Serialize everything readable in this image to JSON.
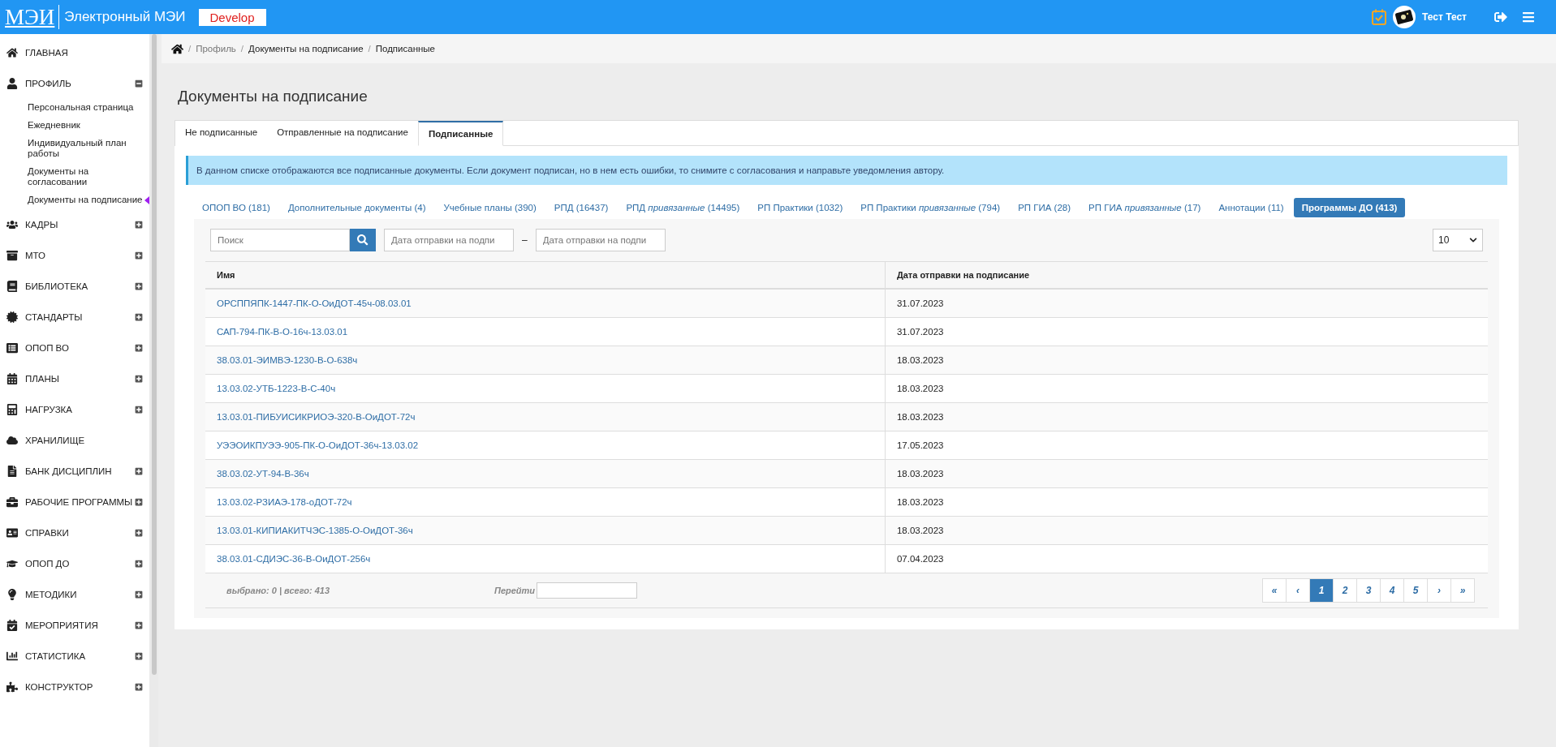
{
  "header": {
    "logo": "МЭИ",
    "title": "Электронный МЭИ",
    "badge": "Develop",
    "user": "Тест Тест"
  },
  "sidebar": {
    "items": [
      {
        "label": "ГЛАВНАЯ",
        "kind": "link"
      },
      {
        "label": "ПРОФИЛЬ",
        "kind": "group",
        "expanded": true,
        "children": [
          {
            "label": "Персональная страница",
            "selected": false
          },
          {
            "label": "Ежедневник",
            "selected": false
          },
          {
            "label": "Индивидуальный план работы",
            "selected": false
          },
          {
            "label": "Документы на согласовании",
            "selected": false
          },
          {
            "label": "Документы на подписание",
            "selected": true
          }
        ]
      },
      {
        "label": "КАДРЫ",
        "kind": "group",
        "expanded": false
      },
      {
        "label": "МТО",
        "kind": "group",
        "expanded": false
      },
      {
        "label": "БИБЛИОТЕКА",
        "kind": "group",
        "expanded": false
      },
      {
        "label": "СТАНДАРТЫ",
        "kind": "group",
        "expanded": false
      },
      {
        "label": "ОПОП ВО",
        "kind": "group",
        "expanded": false
      },
      {
        "label": "ПЛАНЫ",
        "kind": "group",
        "expanded": false
      },
      {
        "label": "НАГРУЗКА",
        "kind": "group",
        "expanded": false
      },
      {
        "label": "ХРАНИЛИЩЕ",
        "kind": "link"
      },
      {
        "label": "БАНК ДИСЦИПЛИН",
        "kind": "group",
        "expanded": false
      },
      {
        "label": "РАБОЧИЕ ПРОГРАММЫ",
        "kind": "group",
        "expanded": false
      },
      {
        "label": "СПРАВКИ",
        "kind": "group",
        "expanded": false
      },
      {
        "label": "ОПОП ДО",
        "kind": "group",
        "expanded": false
      },
      {
        "label": "МЕТОДИКИ",
        "kind": "group",
        "expanded": false
      },
      {
        "label": "МЕРОПРИЯТИЯ",
        "kind": "group",
        "expanded": false
      },
      {
        "label": "СТАТИСТИКА",
        "kind": "group",
        "expanded": false
      },
      {
        "label": "КОНСТРУКТОР",
        "kind": "group",
        "expanded": false
      }
    ]
  },
  "breadcrumb_separator": "/",
  "breadcrumbs": [
    {
      "label": "Профиль",
      "kind": "muted"
    },
    {
      "label": "Документы на подписание",
      "kind": "link"
    },
    {
      "label": "Подписанные",
      "kind": "current"
    }
  ],
  "page_title": "Документы на подписание",
  "tabs": [
    {
      "label": "Не подписанные",
      "selected": false
    },
    {
      "label": "Отправленные на подписание",
      "selected": false
    },
    {
      "label": "Подписанные",
      "selected": true
    }
  ],
  "info": "В данном списке отображаются все подписанные документы. Если документ подписан, но в нем есть ошибки, то снимите с согласования и направьте уведомления автору.",
  "categories": [
    {
      "label": "ОПОП ВО (181)",
      "selected": false
    },
    {
      "label": "Дополнительные документы (4)",
      "selected": false
    },
    {
      "label": "Учебные планы (390)",
      "selected": false
    },
    {
      "label": "РПД (16437)",
      "selected": false
    },
    {
      "label": "РПД *привязанные* (14495)",
      "selected": false
    },
    {
      "label": "РП Практики (1032)",
      "selected": false
    },
    {
      "label": "РП Практики *привязанные* (794)",
      "selected": false
    },
    {
      "label": "РП ГИА (28)",
      "selected": false
    },
    {
      "label": "РП ГИА *привязанные* (17)",
      "selected": false
    },
    {
      "label": "Аннотации (11)",
      "selected": false
    },
    {
      "label": "Программы ДО (413)",
      "selected": true
    }
  ],
  "filters": {
    "search": {
      "placeholder": "Поиск"
    },
    "date_from": {
      "placeholder": "Дата отправки на подпи"
    },
    "separator": "–",
    "date_to": {
      "placeholder": "Дата отправки на подпи"
    },
    "page_size": "10"
  },
  "table": {
    "columns": [
      "Имя",
      "Дата отправки на подписание"
    ],
    "rows": [
      [
        "ОРСППЯПК-1447-ПК-О-ОиДОТ-45ч-08.03.01",
        "31.07.2023"
      ],
      [
        "САП-794-ПК-В-О-16ч-13.03.01",
        "31.07.2023"
      ],
      [
        "38.03.01-ЭИМВЭ-1230-В-О-638ч",
        "18.03.2023"
      ],
      [
        "13.03.02-УТБ-1223-В-С-40ч",
        "18.03.2023"
      ],
      [
        "13.03.01-ПИБУИСИКРИОЭ-320-В-ОиДОТ-72ч",
        "18.03.2023"
      ],
      [
        "УЭЭОИКПУЭЭ-905-ПК-О-ОиДОТ-36ч-13.03.02",
        "17.05.2023"
      ],
      [
        "38.03.02-УТ-94-В-36ч",
        "18.03.2023"
      ],
      [
        "13.03.02-РЗИАЭ-178-оДОТ-72ч",
        "18.03.2023"
      ],
      [
        "13.03.01-КИПИАКИТЧЭС-1385-О-ОиДОТ-36ч",
        "18.03.2023"
      ],
      [
        "38.03.01-СДИЭС-36-В-ОиДОТ-256ч",
        "07.04.2023"
      ]
    ]
  },
  "footer": {
    "summary": "выбрано: 0 | всего: 413",
    "goto_label": "Перейти"
  },
  "pagination": [
    {
      "label": "«",
      "selected": false
    },
    {
      "label": "‹",
      "selected": false
    },
    {
      "label": "1",
      "selected": true
    },
    {
      "label": "2",
      "selected": false
    },
    {
      "label": "3",
      "selected": false
    },
    {
      "label": "4",
      "selected": false
    },
    {
      "label": "5",
      "selected": false
    },
    {
      "label": "›",
      "selected": false
    },
    {
      "label": "»",
      "selected": false
    }
  ]
}
